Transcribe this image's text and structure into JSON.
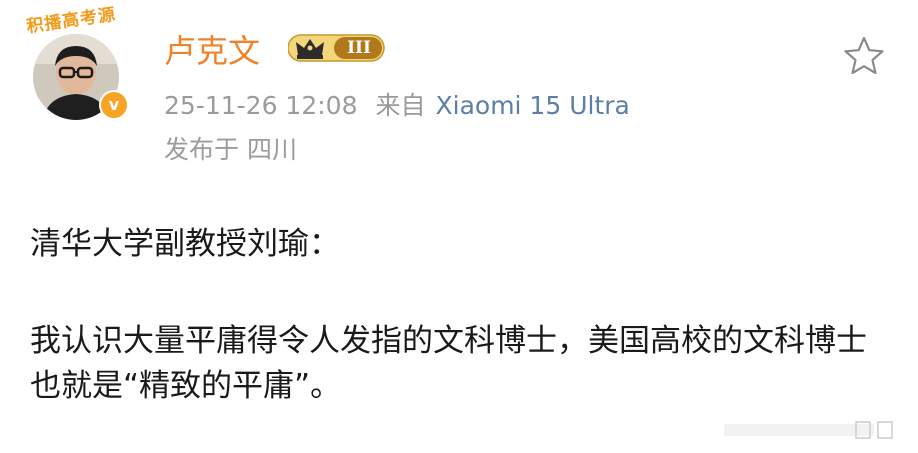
{
  "post": {
    "avatar_banner": "积播高考源",
    "author": "卢克文",
    "member_level": "III",
    "verified_mark": "v",
    "timestamp": "25-11-26 12:08",
    "source_prefix": "来自",
    "device": "Xiaomi 15 Ultra",
    "location": "发布于 四川",
    "paragraphs": [
      "清华大学副教授刘瑜：",
      "我认识大量平庸得令人发指的文科博士，美国高校的文科博士也就是“精致的平庸”。"
    ]
  },
  "icons": {
    "star": "star-outline-icon",
    "crown": "crown-icon",
    "verified": "verified-v-icon"
  },
  "colors": {
    "author": "#f0832a",
    "meta": "#9b9b9b",
    "device_link": "#5b7fa7",
    "badge_gold": "#f7a325",
    "text": "#1a1a1a"
  }
}
